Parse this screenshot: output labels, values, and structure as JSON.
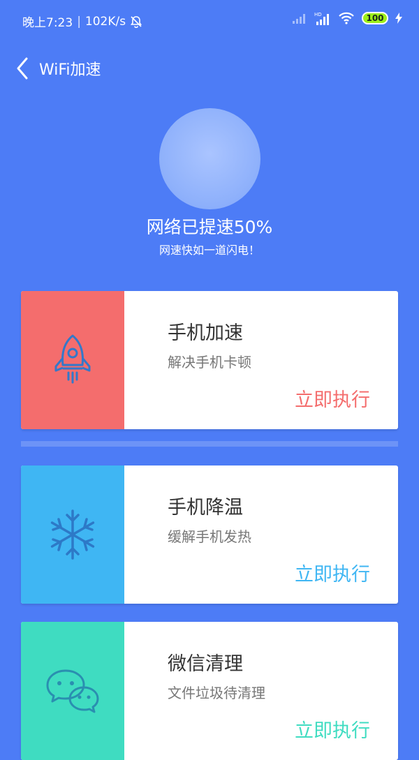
{
  "status_bar": {
    "time": "晚上7:23",
    "network_speed": "102K/s",
    "battery": "100"
  },
  "header": {
    "title": "WiFi加速"
  },
  "hero": {
    "title": "网络已提速50%",
    "subtitle": "网速快如一道闪电！"
  },
  "cards": [
    {
      "title": "手机加速",
      "description": "解决手机卡顿",
      "action": "立即执行",
      "color": "#f46d6d",
      "icon": "rocket-icon"
    },
    {
      "title": "手机降温",
      "description": "缓解手机发热",
      "action": "立即执行",
      "color": "#3fb6f3",
      "icon": "snowflake-icon"
    },
    {
      "title": "微信清理",
      "description": "文件垃圾待清理",
      "action": "立即执行",
      "color": "#3fdcc1",
      "icon": "wechat-icon"
    }
  ],
  "colors": {
    "background": "#4d7cf6"
  }
}
